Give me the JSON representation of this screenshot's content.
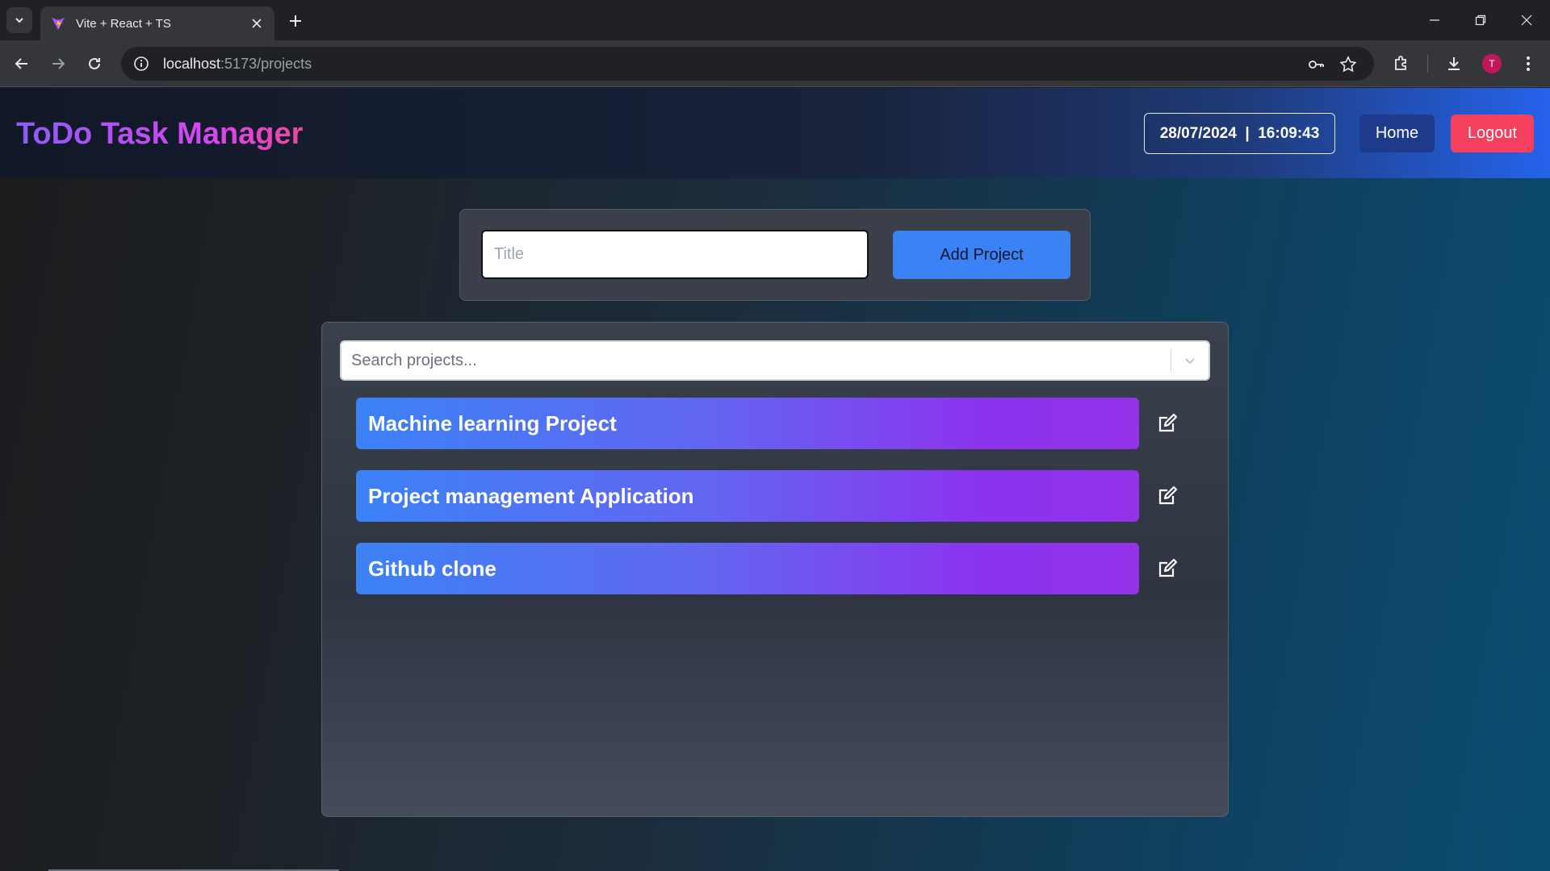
{
  "browser": {
    "tab_title": "Vite + React + TS",
    "url_host": "localhost",
    "url_path": ":5173/projects",
    "profile_initial": "T"
  },
  "header": {
    "title": "ToDo Task Manager",
    "datetime": "28/07/2024  |  16:09:43",
    "home_label": "Home",
    "logout_label": "Logout"
  },
  "add_project": {
    "title_placeholder": "Title",
    "button_label": "Add Project"
  },
  "search": {
    "placeholder": "Search projects..."
  },
  "projects": [
    {
      "name": "Machine learning Project"
    },
    {
      "name": "Project management Application"
    },
    {
      "name": "Github clone"
    }
  ],
  "colors": {
    "accent_blue": "#3b82f6",
    "logout": "#f43f5e",
    "home": "#1e3a8a"
  }
}
